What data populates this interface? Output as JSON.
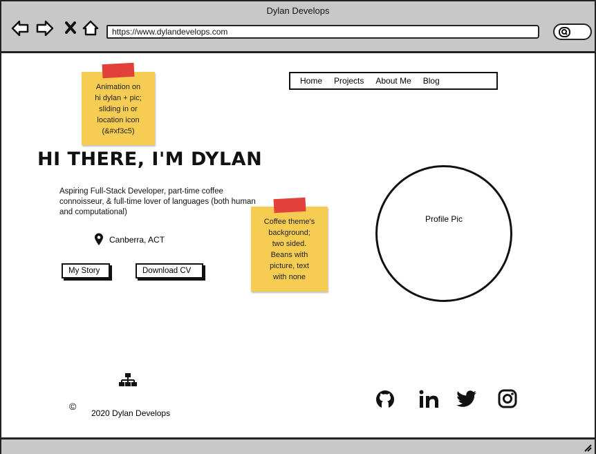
{
  "window": {
    "title": "Dylan Develops"
  },
  "browser": {
    "url": "https://www.dylandevelops.com",
    "icons": [
      "back-icon",
      "forward-icon",
      "close-icon",
      "home-icon",
      "search-icon"
    ]
  },
  "nav": {
    "items": [
      "Home",
      "Projects",
      "About Me",
      "Blog"
    ]
  },
  "notes": {
    "note1": {
      "lines": [
        "Animation on",
        "hi dylan + pic;",
        "sliding in or",
        "location icon",
        "(&#xf3c5)"
      ]
    },
    "note2": {
      "lines": [
        "Coffee theme's",
        "background;",
        "two sided.",
        "Beans with",
        "picture, text",
        "with none"
      ]
    }
  },
  "hero": {
    "heading": "HI THERE, I'M DYLAN",
    "bio": "Aspiring Full-Stack Developer, part-time coffee connoisseur, & full-time lover of languages (both human and computational)",
    "location": "Canberra, ACT",
    "buttons": {
      "story": "My Story",
      "cv": "Download CV"
    }
  },
  "profile": {
    "label": "Profile Pic"
  },
  "footer": {
    "copyright_symbol": "©",
    "text": "2020 Dylan Develops",
    "social": [
      "github-icon",
      "linkedin-icon",
      "twitter-icon",
      "instagram-icon"
    ]
  },
  "colors": {
    "sticky": "#f6cd52",
    "tape": "#e2403a",
    "chrome": "#c8c8c8",
    "backdrop": "#1e6a5e"
  }
}
